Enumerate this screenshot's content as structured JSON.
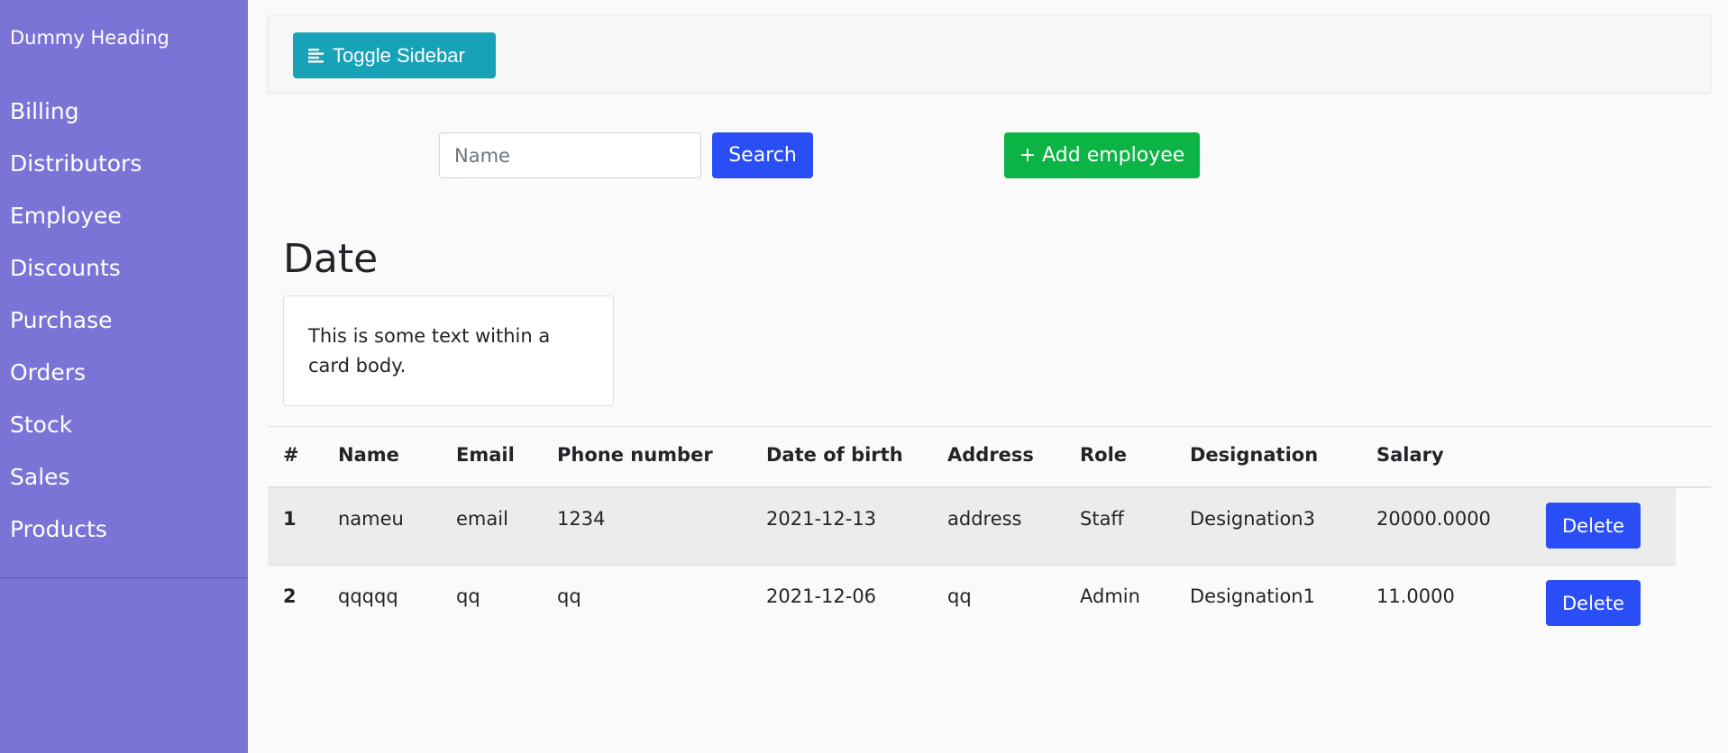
{
  "sidebar": {
    "heading": "Dummy Heading",
    "items": [
      {
        "label": "Billing"
      },
      {
        "label": "Distributors"
      },
      {
        "label": "Employee"
      },
      {
        "label": "Discounts"
      },
      {
        "label": "Purchase"
      },
      {
        "label": "Orders"
      },
      {
        "label": "Stock"
      },
      {
        "label": "Sales"
      },
      {
        "label": "Products"
      }
    ]
  },
  "navbar": {
    "toggle_label": "Toggle Sidebar",
    "toggle_icon": "align-left-icon"
  },
  "search": {
    "placeholder": "Name",
    "value": "",
    "search_label": "Search",
    "add_label": "+ Add employee"
  },
  "section": {
    "title": "Date",
    "card_text": "This is some text within a card body."
  },
  "table": {
    "columns": [
      "#",
      "Name",
      "Email",
      "Phone number",
      "Date of birth",
      "Address",
      "Role",
      "Designation",
      "Salary"
    ],
    "rows": [
      {
        "idx": "1",
        "name": "nameu",
        "email": "email",
        "phone": "1234",
        "dob": "2021-12-13",
        "address": "address",
        "role": "Staff",
        "designation": "Designation3",
        "salary": "20000.0000",
        "action": "Delete"
      },
      {
        "idx": "2",
        "name": "qqqqq",
        "email": "qq",
        "phone": "qq",
        "dob": "2021-12-06",
        "address": "qq",
        "role": "Admin",
        "designation": "Designation1",
        "salary": "11.0000",
        "action": "Delete"
      }
    ]
  },
  "colors": {
    "sidebar_bg": "#7b74d7",
    "toggle_bg": "#17a2b8",
    "primary": "#2a4ef5",
    "success": "#0bb445"
  }
}
